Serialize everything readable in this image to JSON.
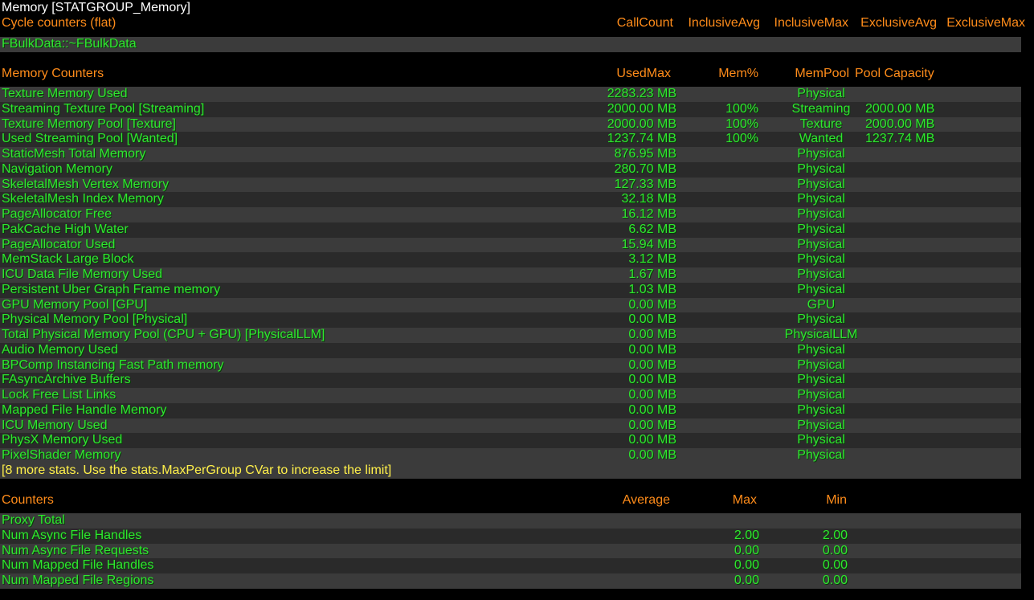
{
  "group_title": "Memory [STATGROUP_Memory]",
  "cycle": {
    "title": "Cycle counters (flat)",
    "headers": [
      "CallCount",
      "InclusiveAvg",
      "InclusiveMax",
      "ExclusiveAvg",
      "ExclusiveMax"
    ],
    "rows": [
      "FBulkData::~FBulkData"
    ]
  },
  "memory": {
    "title": "Memory Counters",
    "headers": {
      "used_max": "UsedMax",
      "mem_pct": "Mem%",
      "mem_pool": "MemPool",
      "pool_capacity": "Pool Capacity"
    },
    "rows": [
      {
        "name": "Texture Memory Used",
        "used": "2283.23 MB",
        "pct": "",
        "pool": "Physical",
        "cap": ""
      },
      {
        "name": "Streaming Texture Pool [Streaming]",
        "used": "2000.00 MB",
        "pct": "100%",
        "pool": "Streaming",
        "cap": "2000.00 MB"
      },
      {
        "name": "Texture Memory Pool [Texture]",
        "used": "2000.00 MB",
        "pct": "100%",
        "pool": "Texture",
        "cap": "2000.00 MB"
      },
      {
        "name": "Used Streaming Pool [Wanted]",
        "used": "1237.74 MB",
        "pct": "100%",
        "pool": "Wanted",
        "cap": "1237.74 MB"
      },
      {
        "name": "StaticMesh Total Memory",
        "used": "876.95 MB",
        "pct": "",
        "pool": "Physical",
        "cap": ""
      },
      {
        "name": "Navigation Memory",
        "used": "280.70 MB",
        "pct": "",
        "pool": "Physical",
        "cap": ""
      },
      {
        "name": "SkeletalMesh Vertex Memory",
        "used": "127.33 MB",
        "pct": "",
        "pool": "Physical",
        "cap": ""
      },
      {
        "name": "SkeletalMesh Index Memory",
        "used": "32.18 MB",
        "pct": "",
        "pool": "Physical",
        "cap": ""
      },
      {
        "name": "PageAllocator Free",
        "used": "16.12 MB",
        "pct": "",
        "pool": "Physical",
        "cap": ""
      },
      {
        "name": "PakCache High Water",
        "used": "6.62 MB",
        "pct": "",
        "pool": "Physical",
        "cap": ""
      },
      {
        "name": "PageAllocator Used",
        "used": "15.94 MB",
        "pct": "",
        "pool": "Physical",
        "cap": ""
      },
      {
        "name": "MemStack Large Block",
        "used": "3.12 MB",
        "pct": "",
        "pool": "Physical",
        "cap": ""
      },
      {
        "name": "ICU Data File Memory Used",
        "used": "1.67 MB",
        "pct": "",
        "pool": "Physical",
        "cap": ""
      },
      {
        "name": "Persistent Uber Graph Frame memory",
        "used": "1.03 MB",
        "pct": "",
        "pool": "Physical",
        "cap": ""
      },
      {
        "name": "GPU Memory Pool [GPU]",
        "used": "0.00 MB",
        "pct": "",
        "pool": "GPU",
        "cap": ""
      },
      {
        "name": "Physical Memory Pool [Physical]",
        "used": "0.00 MB",
        "pct": "",
        "pool": "Physical",
        "cap": ""
      },
      {
        "name": "Total Physical Memory Pool (CPU + GPU) [PhysicalLLM]",
        "used": "0.00 MB",
        "pct": "",
        "pool": "PhysicalLLM",
        "cap": ""
      },
      {
        "name": "Audio Memory Used",
        "used": "0.00 MB",
        "pct": "",
        "pool": "Physical",
        "cap": ""
      },
      {
        "name": "BPComp Instancing Fast Path memory",
        "used": "0.00 MB",
        "pct": "",
        "pool": "Physical",
        "cap": ""
      },
      {
        "name": "FAsyncArchive Buffers",
        "used": "0.00 MB",
        "pct": "",
        "pool": "Physical",
        "cap": ""
      },
      {
        "name": "Lock Free List Links",
        "used": "0.00 MB",
        "pct": "",
        "pool": "Physical",
        "cap": ""
      },
      {
        "name": "Mapped File Handle Memory",
        "used": "0.00 MB",
        "pct": "",
        "pool": "Physical",
        "cap": ""
      },
      {
        "name": "ICU Memory Used",
        "used": "0.00 MB",
        "pct": "",
        "pool": "Physical",
        "cap": ""
      },
      {
        "name": "PhysX Memory Used",
        "used": "0.00 MB",
        "pct": "",
        "pool": "Physical",
        "cap": ""
      },
      {
        "name": "PixelShader Memory",
        "used": "0.00 MB",
        "pct": "",
        "pool": "Physical",
        "cap": ""
      }
    ],
    "more_note": "[8 more stats. Use the stats.MaxPerGroup CVar to increase the limit]"
  },
  "counters": {
    "title": "Counters",
    "headers": {
      "average": "Average",
      "max": "Max",
      "min": "Min"
    },
    "rows": [
      {
        "name": "Proxy Total",
        "avg": "",
        "max": "",
        "min": ""
      },
      {
        "name": "Num Async File Handles",
        "avg": "",
        "max": "2.00",
        "min": "2.00"
      },
      {
        "name": "Num Async File Requests",
        "avg": "",
        "max": "0.00",
        "min": "0.00"
      },
      {
        "name": "Num Mapped File Handles",
        "avg": "",
        "max": "0.00",
        "min": "0.00"
      },
      {
        "name": "Num Mapped File Regions",
        "avg": "",
        "max": "0.00",
        "min": "0.00"
      }
    ]
  },
  "colors": {
    "header": "#ff8c1a",
    "value": "#2fe62f",
    "title": "#ffffff",
    "note": "#fff04a"
  }
}
